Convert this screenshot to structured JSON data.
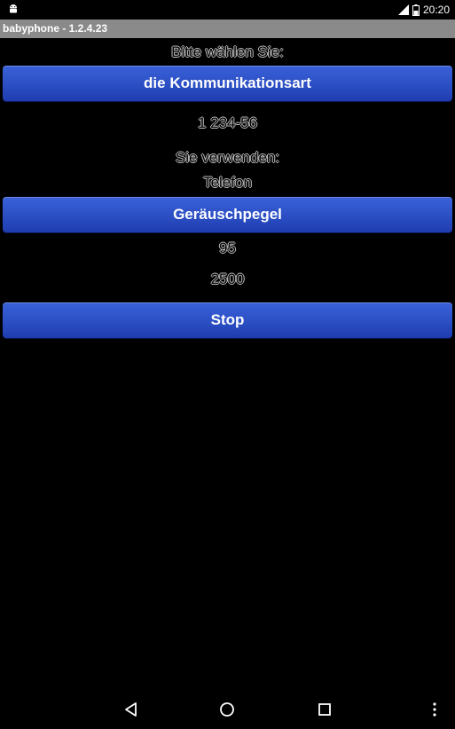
{
  "status_bar": {
    "time": "20:20",
    "icons": [
      "android-icon",
      "signal-icon",
      "battery-icon"
    ]
  },
  "app": {
    "title": "babyphone - 1.2.4.23"
  },
  "main": {
    "choose_label": "Bitte wählen Sie:",
    "communication_button": "die Kommunikationsart",
    "phone_number": "1 234-56",
    "using_label": "Sie verwenden:",
    "communication_mode": "Telefon",
    "noise_button": "Geräuschpegel",
    "noise_level": "95",
    "delay_value": "2500",
    "stop_button": "Stop"
  },
  "nav_bar": {
    "icons": [
      "back-icon",
      "home-icon",
      "recents-icon",
      "overflow-menu-icon"
    ]
  },
  "colors": {
    "background": "#000000",
    "title_bar": "#8a8a8a",
    "button_blue": "#2e52c8",
    "emboss_outline": "#bdbdbd"
  }
}
